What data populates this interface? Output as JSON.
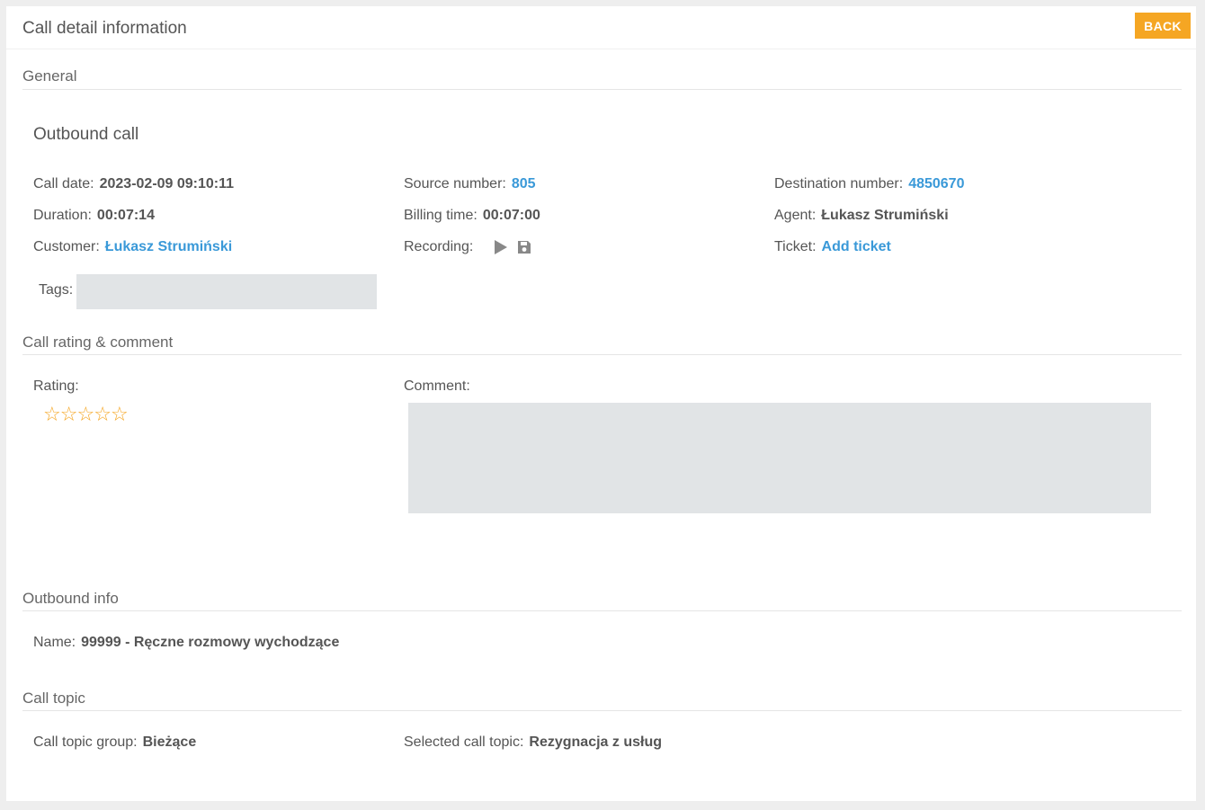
{
  "header": {
    "title": "Call detail information",
    "back_label": "BACK",
    "back_color": "#f5a623"
  },
  "general": {
    "section_title": "General",
    "call_type": "Outbound call",
    "call_date": {
      "label": "Call date:",
      "value": "2023-02-09 09:10:11"
    },
    "source_number": {
      "label": "Source number:",
      "value": "805"
    },
    "destination_number": {
      "label": "Destination number:",
      "value": "4850670"
    },
    "duration": {
      "label": "Duration:",
      "value": "00:07:14"
    },
    "billing_time": {
      "label": "Billing time:",
      "value": "00:07:00"
    },
    "agent": {
      "label": "Agent:",
      "value": "Łukasz Strumiński"
    },
    "customer": {
      "label": "Customer:",
      "value": "Łukasz Strumiński"
    },
    "recording": {
      "label": "Recording:",
      "icons": [
        "play-icon",
        "save-icon"
      ]
    },
    "ticket": {
      "label": "Ticket:",
      "value": "Add ticket"
    },
    "tags": {
      "label": "Tags:",
      "value": ""
    }
  },
  "rating": {
    "section_title": "Call rating & comment",
    "rating_label": "Rating:",
    "rating_value": 0,
    "rating_max": 5,
    "star_glyph": "☆",
    "comment_label": "Comment:",
    "comment_value": ""
  },
  "outbound": {
    "section_title": "Outbound info",
    "name": {
      "label": "Name:",
      "value": "99999 - Ręczne rozmowy wychodzące"
    }
  },
  "topic": {
    "section_title": "Call topic",
    "group": {
      "label": "Call topic group:",
      "value": "Bieżące"
    },
    "selected": {
      "label": "Selected call topic:",
      "value": "Rezygnacja z usług"
    }
  },
  "colors": {
    "accent": "#f5a623",
    "link": "#3a99d8",
    "field_bg": "#e1e4e6"
  }
}
